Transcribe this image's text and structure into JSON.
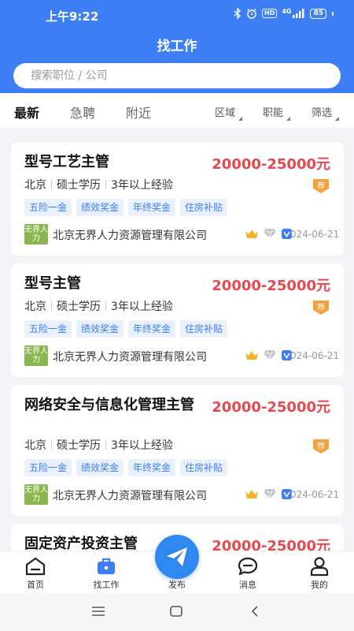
{
  "status_bar": {
    "time": "上午9:22",
    "battery": "85",
    "network": "4G",
    "hd": "HD"
  },
  "header": {
    "title": "找工作",
    "search_placeholder": "搜索职位 / 公司"
  },
  "tabs": [
    {
      "label": "最新",
      "active": true
    },
    {
      "label": "急聘",
      "active": false
    },
    {
      "label": "附近",
      "active": false
    }
  ],
  "filters": [
    {
      "label": "区域"
    },
    {
      "label": "职能"
    },
    {
      "label": "筛选"
    }
  ],
  "jobs": [
    {
      "title": "型号工艺主管",
      "salary": "20000-25000元",
      "location": "北京",
      "education": "硕士学历",
      "experience": "3年以上经验",
      "recommended_badge": "荐",
      "tags": [
        "五险一金",
        "绩效奖金",
        "年终奖金",
        "住房补贴"
      ],
      "company_logo_text": "无界人力",
      "company": "北京无界人力资源管理有限公司",
      "date_fragment": "024-06-21"
    },
    {
      "title": "型号主管",
      "salary": "20000-25000元",
      "location": "北京",
      "education": "硕士学历",
      "experience": "3年以上经验",
      "recommended_badge": "荐",
      "tags": [
        "五险一金",
        "绩效奖金",
        "年终奖金",
        "住房补贴"
      ],
      "company_logo_text": "无界人力",
      "company": "北京无界人力资源管理有限公司",
      "date_fragment": "024-06-21"
    },
    {
      "title": "网络安全与信息化管理主管",
      "salary": "20000-25000元",
      "location": "北京",
      "education": "硕士学历",
      "experience": "3年以上经验",
      "recommended_badge": "荐",
      "tags": [
        "五险一金",
        "绩效奖金",
        "年终奖金",
        "住房补贴"
      ],
      "company_logo_text": "无界人力",
      "company": "北京无界人力资源管理有限公司",
      "date_fragment": "024-06-21"
    },
    {
      "title": "固定资产投资主管",
      "salary": "20000-25000元"
    }
  ],
  "bottom_nav": [
    {
      "label": "首页",
      "icon": "home-icon"
    },
    {
      "label": "找工作",
      "icon": "briefcase-icon",
      "active": true
    },
    {
      "label": "发布",
      "icon": "paper-plane-icon"
    },
    {
      "label": "消息",
      "icon": "chat-icon"
    },
    {
      "label": "我的",
      "icon": "user-icon"
    }
  ],
  "colors": {
    "primary": "#3d7ef4",
    "salary": "#e5484d",
    "tag_bg": "#e8f1fd",
    "badge": "#f5a13c",
    "company_logo": "#8ab64f"
  }
}
